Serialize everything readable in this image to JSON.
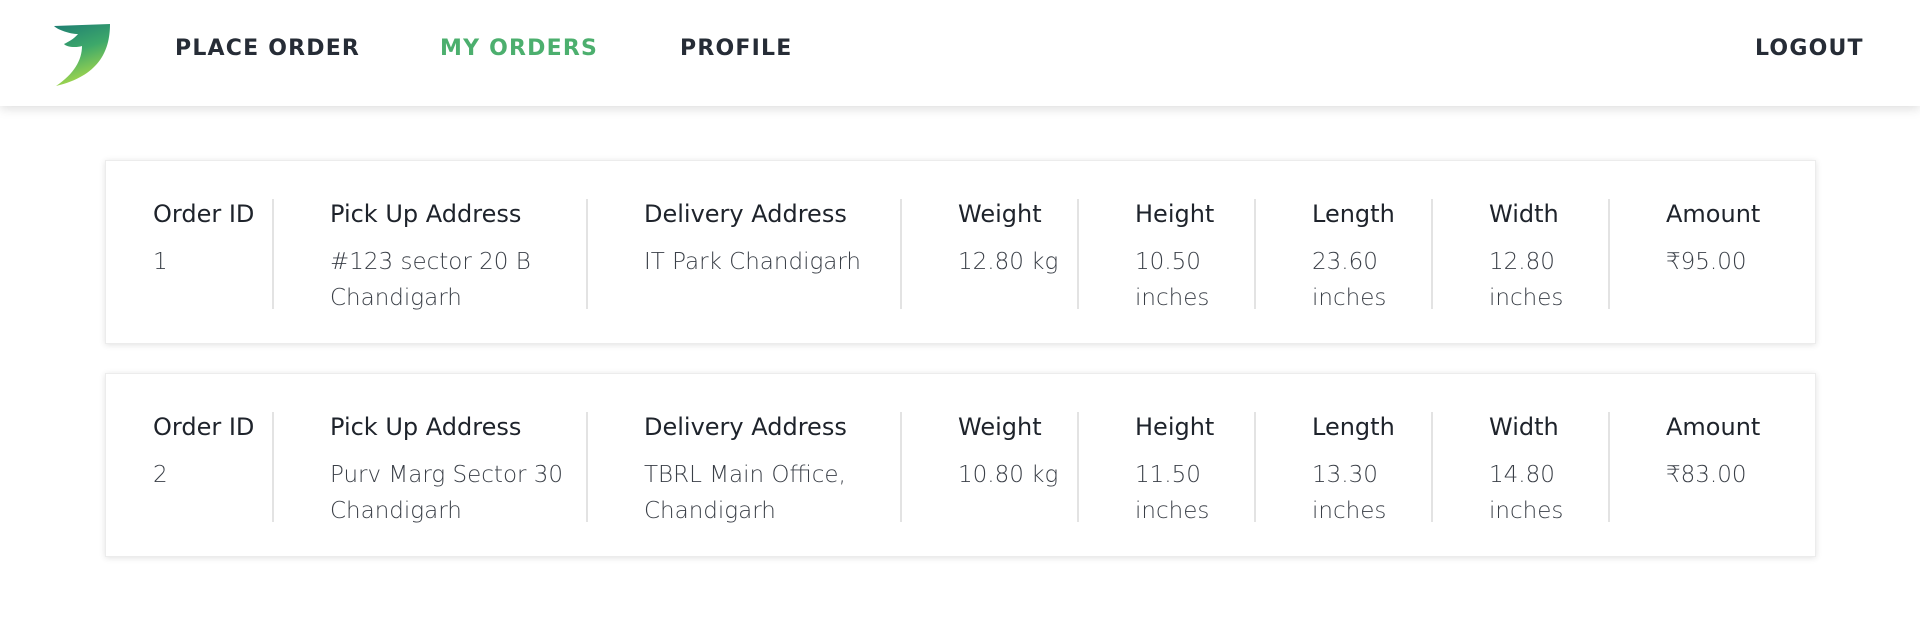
{
  "nav": {
    "logo_icon": "leaf-logo",
    "place_order": "PLACE ORDER",
    "my_orders": "MY ORDERS",
    "profile": "PROFILE",
    "logout": "LOGOUT",
    "active_color": "#4caf6e",
    "text_color": "#262c36"
  },
  "labels": {
    "order_id": "Order ID",
    "pickup": "Pick Up Address",
    "delivery": "Delivery Address",
    "weight": "Weight",
    "height": "Height",
    "length": "Length",
    "width": "Width",
    "amount": "Amount"
  },
  "orders": [
    {
      "id": "1",
      "pickup": "#123 sector 20 B Chandigarh",
      "delivery": "IT Park Chandigarh",
      "weight": "12.80 kg",
      "height": "10.50 inches",
      "length": "23.60 inches",
      "width": "12.80 inches",
      "amount": "₹95.00"
    },
    {
      "id": "2",
      "pickup": "Purv Marg Sector 30 Chandigarh",
      "delivery": "TBRL Main Office, Chandigarh",
      "weight": "10.80 kg",
      "height": "11.50 inches",
      "length": "13.30 inches",
      "width": "14.80 inches",
      "amount": "₹83.00"
    }
  ]
}
